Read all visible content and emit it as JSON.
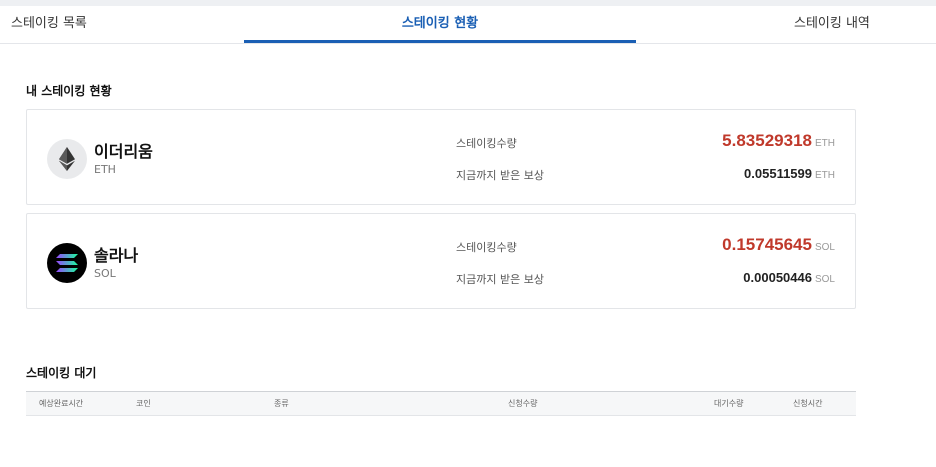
{
  "tabs": [
    {
      "label": "스테이킹 목록",
      "active": false
    },
    {
      "label": "스테이킹 현황",
      "active": true
    },
    {
      "label": "스테이킹 내역",
      "active": false
    }
  ],
  "colors": {
    "accent": "#1a5fb4",
    "amount_red": "#c0392b"
  },
  "my_staking": {
    "title": "내 스테이킹 현황",
    "coins": [
      {
        "name": "이더리움",
        "symbol": "ETH",
        "icon": "ethereum-icon",
        "staked_label": "스테이킹수량",
        "staked_amount": "5.83529318",
        "reward_label": "지금까지 받은 보상",
        "reward_amount": "0.05511599",
        "unit": "ETH"
      },
      {
        "name": "솔라나",
        "symbol": "SOL",
        "icon": "solana-icon",
        "staked_label": "스테이킹수량",
        "staked_amount": "0.15745645",
        "reward_label": "지금까지 받은 보상",
        "reward_amount": "0.00050446",
        "unit": "SOL"
      }
    ]
  },
  "waiting": {
    "title": "스테이킹 대기",
    "columns": [
      "예상완료시간",
      "코인",
      "종류",
      "신청수량",
      "대기수량",
      "신청시간"
    ]
  }
}
